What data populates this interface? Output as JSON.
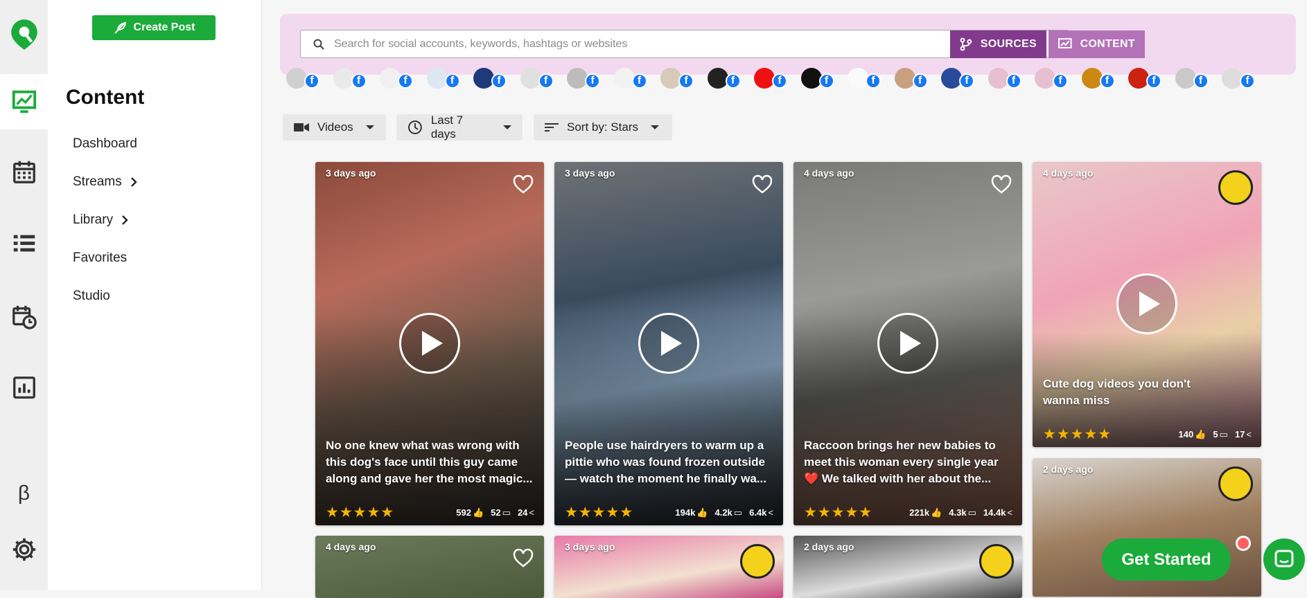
{
  "panel": {
    "create_label": "Create Post",
    "title": "Content",
    "nav": [
      "Dashboard",
      "Streams",
      "Library",
      "Favorites",
      "Studio"
    ]
  },
  "search": {
    "placeholder": "Search for social accounts, keywords, hashtags or websites"
  },
  "tabs": {
    "sources": "SOURCES",
    "content": "CONTENT"
  },
  "rail": {
    "beta": "β"
  },
  "filters": {
    "type": "Videos",
    "range": "Last 7 days",
    "sort": "Sort by: Stars"
  },
  "avatar_source_letter": "f",
  "avatar_badge_count": 21,
  "cards": [
    {
      "age": "3 days ago",
      "caption": "No one knew what was wrong with this dog's face until this guy came along and gave her the most magic...",
      "stars": "★★★★★",
      "likes": "592",
      "comments": "52",
      "shares": "24"
    },
    {
      "age": "3 days ago",
      "caption": "People use hairdryers to warm up a pittie who was found frozen outside — watch the moment he finally wa...",
      "stars": "★★★★★",
      "likes": "194k",
      "comments": "4.2k",
      "shares": "6.4k"
    },
    {
      "age": "4 days ago",
      "caption": "Raccoon brings her new babies to meet this woman every single year ❤️ We talked with her about the...",
      "stars": "★★★★★",
      "likes": "221k",
      "comments": "4.3k",
      "shares": "14.4k"
    },
    {
      "age": "4 days ago",
      "caption": "Cute dog videos you don't wanna miss",
      "stars": "★★★★★",
      "likes": "140",
      "comments": "5",
      "shares": "17"
    },
    {
      "age": "2 days ago"
    },
    {
      "age": "4 days ago"
    },
    {
      "age": "3 days ago"
    },
    {
      "age": "2 days ago"
    }
  ],
  "cta": {
    "label": "Get Started"
  },
  "colors": {
    "brand_green": "#1bab3b",
    "sources_purple": "#813a8c",
    "content_purple": "#b371b7",
    "search_bg": "#f3d9f0",
    "star": "#f5b400"
  }
}
